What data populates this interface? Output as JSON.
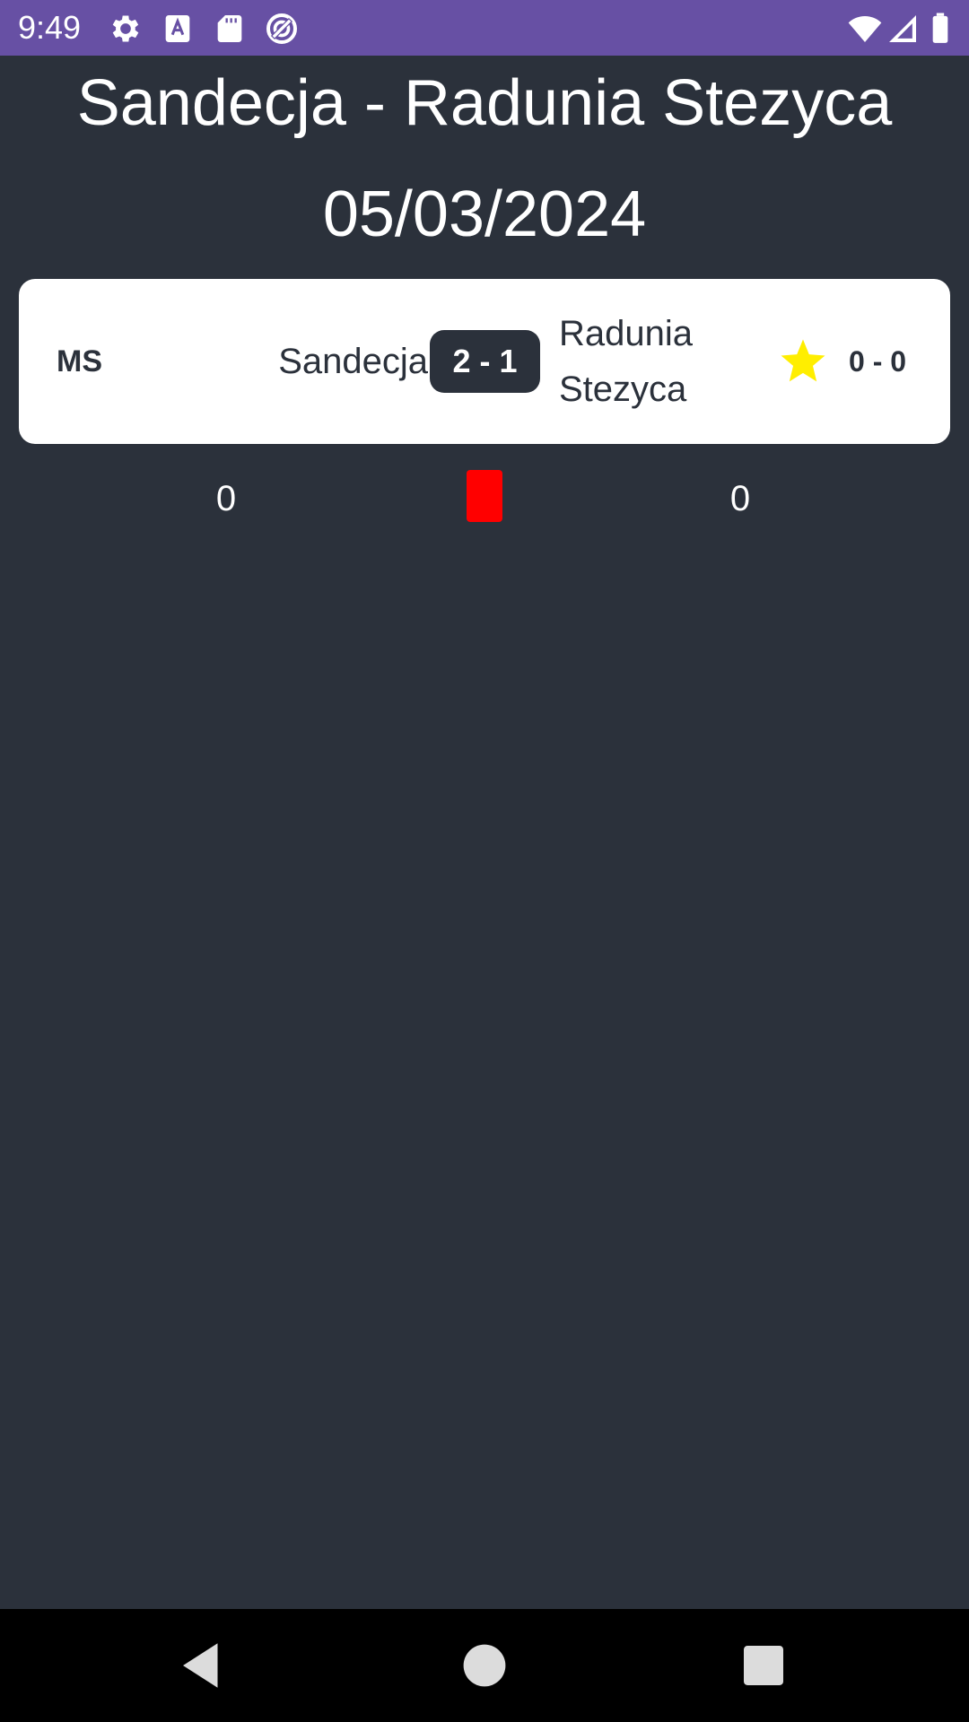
{
  "status_bar": {
    "time": "9:49",
    "icons_left": [
      "gear-icon",
      "text-a-icon",
      "sd-card-icon",
      "no-disturb-icon"
    ],
    "icons_right": [
      "wifi-icon",
      "signal-icon",
      "battery-icon"
    ],
    "background_color": "#6750a4"
  },
  "header": {
    "title": "Sandecja - Radunia Stezyca",
    "date": "05/03/2024"
  },
  "match": {
    "status": "MS",
    "home_team": "Sandecja",
    "score": "2 - 1",
    "away_team": "Radunia Stezyca",
    "favorite_icon": "star-icon",
    "halftime_score": "0 - 0"
  },
  "cards": {
    "home_red_cards": "0",
    "icon": "red-card-icon",
    "away_red_cards": "0",
    "card_color": "#ff0000"
  },
  "nav_bar": {
    "buttons": [
      "back-icon",
      "home-icon",
      "recents-icon"
    ]
  },
  "colors": {
    "background": "#2b313b",
    "card_background": "#ffffff",
    "star": "#ffee00"
  }
}
